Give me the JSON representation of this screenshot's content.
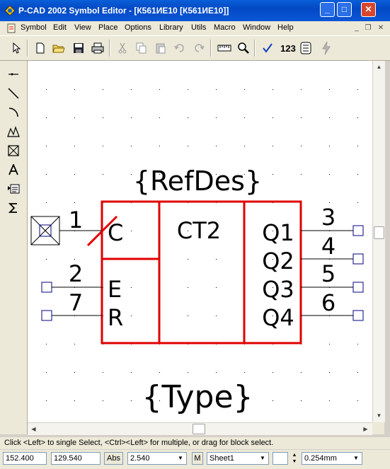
{
  "window": {
    "title": "P-CAD 2002 Symbol Editor - [К561ИЕ10 [К561ИЕ10]]",
    "minimize": "_",
    "maximize": "□",
    "close": "✕"
  },
  "menu": {
    "items": [
      "Symbol",
      "Edit",
      "View",
      "Place",
      "Options",
      "Library",
      "Utils",
      "Macro",
      "Window",
      "Help"
    ],
    "mdi_minimize": "_",
    "mdi_restore": "❐",
    "mdi_close": "✕"
  },
  "toolbar": {
    "number_label": "123"
  },
  "symbol": {
    "refdes": "{RefDes}",
    "type": "{Type}",
    "function": "CT2",
    "pins": {
      "c": {
        "number": "1",
        "name": "C"
      },
      "e": {
        "number": "2",
        "name": "E"
      },
      "r": {
        "number": "7",
        "name": "R"
      },
      "q1": {
        "number": "3",
        "name": "Q1"
      },
      "q2": {
        "number": "4",
        "name": "Q2"
      },
      "q3": {
        "number": "5",
        "name": "Q3"
      },
      "q4": {
        "number": "6",
        "name": "Q4"
      }
    },
    "colors": {
      "body": "#e00000",
      "pins": "#000000",
      "pin_endpoint": "#000080",
      "grid": "#000000"
    }
  },
  "status": {
    "message": "Click <Left> to single Select, <Ctrl><Left> for multiple, or drag for block select.",
    "x_coord": "152.400",
    "y_coord": "129.540",
    "abs_button": "Abs",
    "grid_value": "2.540",
    "m_button": "M",
    "sheet": "Sheet1",
    "line_width": "0.254mm"
  }
}
